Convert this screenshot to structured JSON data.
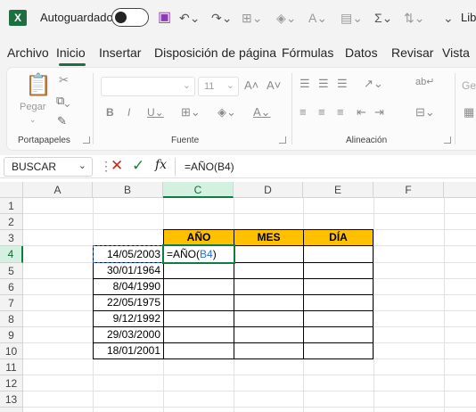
{
  "titlebar": {
    "autosave_label": "Autoguardado",
    "trailing_text": "Lib"
  },
  "menu": {
    "tabs": [
      "Archivo",
      "Inicio",
      "Insertar",
      "Disposición de página",
      "Fórmulas",
      "Datos",
      "Revisar",
      "Vista"
    ],
    "active_index": 1
  },
  "ribbon": {
    "paste_label": "Pegar",
    "groups": [
      "Portapapeles",
      "Fuente",
      "Alineación"
    ],
    "font_size": "11",
    "general_partial": "Ge"
  },
  "formula_bar": {
    "name_box": "BUSCAR",
    "fx": "fx",
    "content": "=AÑO(B4)"
  },
  "sheet": {
    "columns": [
      "A",
      "B",
      "C",
      "D",
      "E",
      "F"
    ],
    "rows": [
      "1",
      "2",
      "3",
      "4",
      "5",
      "6",
      "7",
      "8",
      "9",
      "10",
      "11",
      "12",
      "13"
    ],
    "active_cell": "C4",
    "table_headers": [
      "AÑO",
      "MES",
      "DÍA"
    ],
    "dates": [
      "14/05/2003",
      "30/01/1964",
      "8/04/1990",
      "22/05/1975",
      "9/12/1992",
      "29/03/2000",
      "18/01/2001"
    ],
    "editing": {
      "prefix": "=AÑO(",
      "ref": "B4",
      "suffix": ")"
    }
  },
  "colors": {
    "excel_green": "#107c41",
    "header_fill": "#ffc000",
    "ref_blue": "#2a6fd6"
  }
}
